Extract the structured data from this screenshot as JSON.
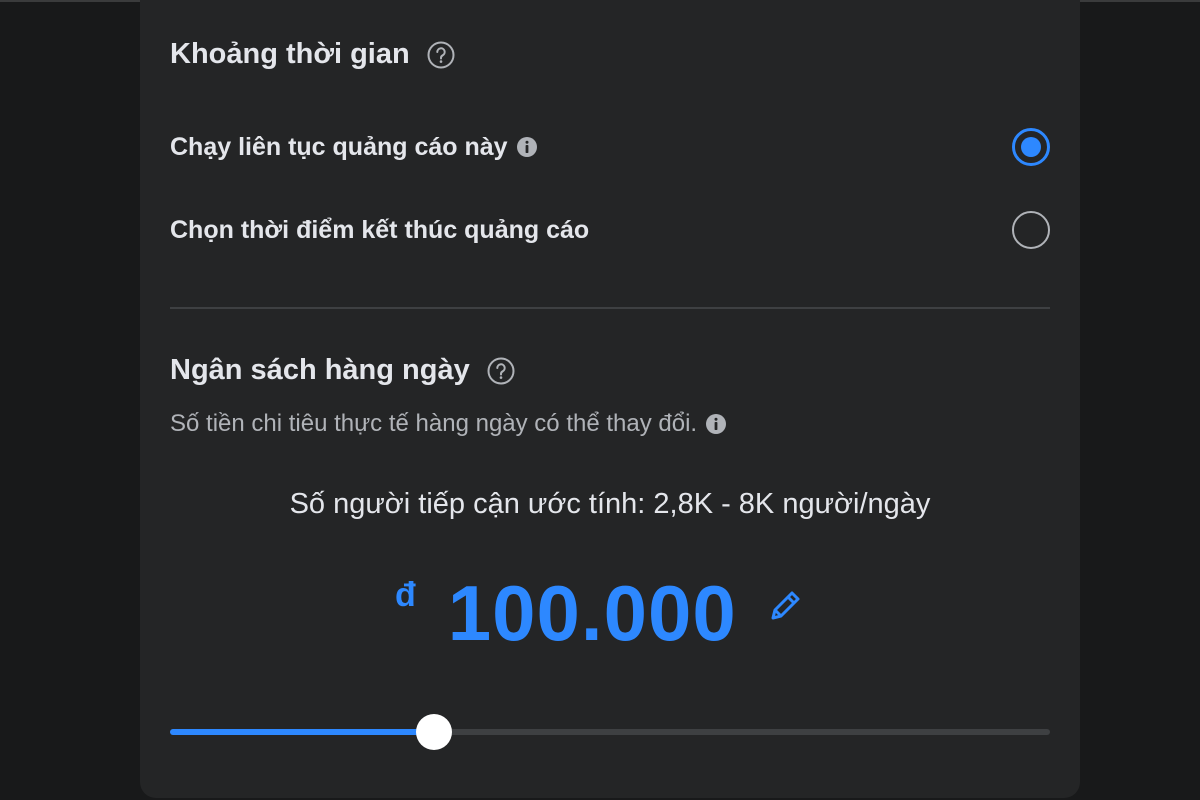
{
  "duration": {
    "title": "Khoảng thời gian",
    "options": [
      {
        "label": "Chạy liên tục quảng cáo này",
        "selected": true
      },
      {
        "label": "Chọn thời điểm kết thúc quảng cáo",
        "selected": false
      }
    ]
  },
  "budget": {
    "title": "Ngân sách hàng ngày",
    "description": "Số tiền chi tiêu thực tế hàng ngày có thể thay đổi.",
    "estimated_reach": "Số người tiếp cận ước tính: 2,8K - 8K người/ngày",
    "currency_symbol": "đ",
    "amount": "100.000",
    "slider_level": 0.3
  },
  "colors": {
    "accent": "#2d88ff",
    "panel": "#242526",
    "text": "#e4e6eb",
    "secondary_text": "#b0b3b8"
  },
  "icons": [
    "help-icon",
    "info-icon",
    "edit-icon"
  ]
}
